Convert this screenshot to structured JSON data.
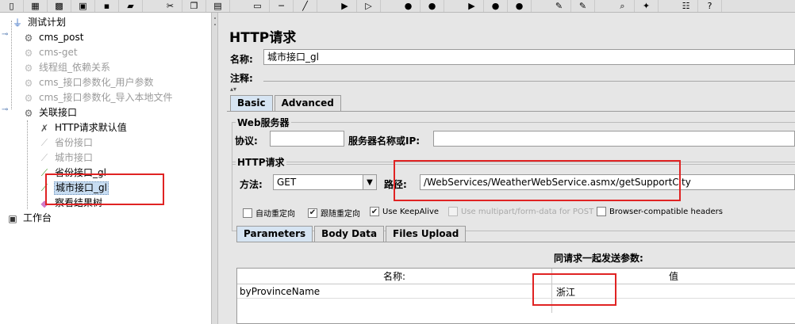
{
  "toolbar": {
    "icons": [
      "new-icon",
      "template-icon",
      "open-icon",
      "close-icon",
      "save-icon",
      "save-as-icon",
      "cut-icon",
      "copy-icon",
      "paste-icon",
      "expand-icon",
      "collapse-icon",
      "toggle-icon",
      "start-icon",
      "start-no-pause-icon",
      "stop-icon",
      "shutdown-icon",
      "remote-start-icon",
      "remote-stop-icon",
      "remote-shutdown-icon",
      "clear-icon",
      "clear-all-icon",
      "search-icon",
      "reset-search-icon",
      "function-helper-icon",
      "help-icon"
    ],
    "glyphs": [
      "▯",
      "▦",
      "▩",
      "▣",
      "▪",
      "▰",
      "✂",
      "❐",
      "▤",
      "▭",
      "─",
      "╱",
      "▶",
      "▷",
      "●",
      "●",
      "▶",
      "●",
      "●",
      "✎",
      "✎",
      "⌕",
      "✦",
      "☷",
      "?"
    ]
  },
  "tree": {
    "items": [
      {
        "label": "测试计划",
        "icon": "test-plan-icon",
        "glyph": "⏚",
        "dim": false
      },
      {
        "label": "cms_post",
        "icon": "thread-group-icon",
        "glyph": "⚙",
        "dim": false
      },
      {
        "label": "cms-get",
        "icon": "thread-group-icon",
        "glyph": "⚙",
        "dim": true
      },
      {
        "label": "线程组_依赖关系",
        "icon": "thread-group-icon",
        "glyph": "⚙",
        "dim": true
      },
      {
        "label": "cms_接口参数化_用户参数",
        "icon": "thread-group-icon",
        "glyph": "⚙",
        "dim": true
      },
      {
        "label": "cms_接口参数化_导入本地文件",
        "icon": "thread-group-icon",
        "glyph": "⚙",
        "dim": true
      },
      {
        "label": "关联接口",
        "icon": "thread-group-icon",
        "glyph": "⚙",
        "dim": false
      },
      {
        "label": "HTTP请求默认值",
        "icon": "config-element-icon",
        "glyph": "✗",
        "dim": false
      },
      {
        "label": "省份接口",
        "icon": "sampler-icon",
        "glyph": "⟋",
        "dim": true
      },
      {
        "label": "城市接口",
        "icon": "sampler-icon",
        "glyph": "⟋",
        "dim": true
      },
      {
        "label": "省份接口_gl",
        "icon": "sampler-icon",
        "glyph": "⟋",
        "dim": false
      },
      {
        "label": "城市接口_gl",
        "icon": "sampler-icon",
        "glyph": "⟋",
        "dim": false
      },
      {
        "label": "察看结果树",
        "icon": "listener-icon",
        "glyph": "◆",
        "dim": false
      },
      {
        "label": "工作台",
        "icon": "workbench-icon",
        "glyph": "▣",
        "dim": false
      }
    ]
  },
  "panel": {
    "title": "HTTP请求",
    "name_label": "名称:",
    "name_value": "城市接口_gl",
    "comment_label": "注释:",
    "comment_value": "",
    "tabs": [
      "Basic",
      "Advanced"
    ],
    "web_server": {
      "legend": "Web服务器",
      "protocol_label": "协议:",
      "protocol_value": "",
      "server_label": "服务器名称或IP:",
      "server_value": ""
    },
    "http_request": {
      "legend": "HTTP请求",
      "method_label": "方法:",
      "method_value": "GET",
      "path_label": "路径:",
      "path_value": "/WebServices/WeatherWebService.asmx/getSupportCity"
    },
    "options": [
      {
        "label": "自动重定向",
        "checked": false,
        "disabled": false
      },
      {
        "label": "跟随重定向",
        "checked": true,
        "disabled": false
      },
      {
        "label": "Use KeepAlive",
        "checked": true,
        "disabled": false
      },
      {
        "label": "Use multipart/form-data for POST",
        "checked": false,
        "disabled": true
      },
      {
        "label": "Browser-compatible headers",
        "checked": false,
        "disabled": false
      }
    ],
    "sub_tabs": [
      "Parameters",
      "Body Data",
      "Files Upload"
    ],
    "params_caption": "同请求一起发送参数:",
    "columns": [
      "名称:",
      "值"
    ],
    "rows": [
      {
        "name": "byProvinceName",
        "value": "浙江"
      }
    ]
  },
  "colors": {
    "highlight": "#e02323",
    "selection": "#c8ddf2"
  }
}
